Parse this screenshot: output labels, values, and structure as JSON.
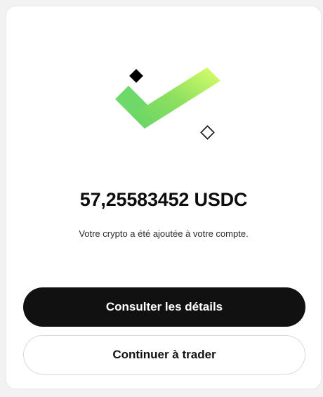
{
  "confirmation": {
    "amount": "57,25583452 USDC",
    "message": "Votre crypto a été ajoutée à votre compte."
  },
  "actions": {
    "details_label": "Consulter les détails",
    "continue_label": "Continuer à trader"
  },
  "illustration": {
    "icon": "checkmark-icon",
    "gradient_start": "#6fd86b",
    "gradient_end": "#d9ff6a"
  }
}
